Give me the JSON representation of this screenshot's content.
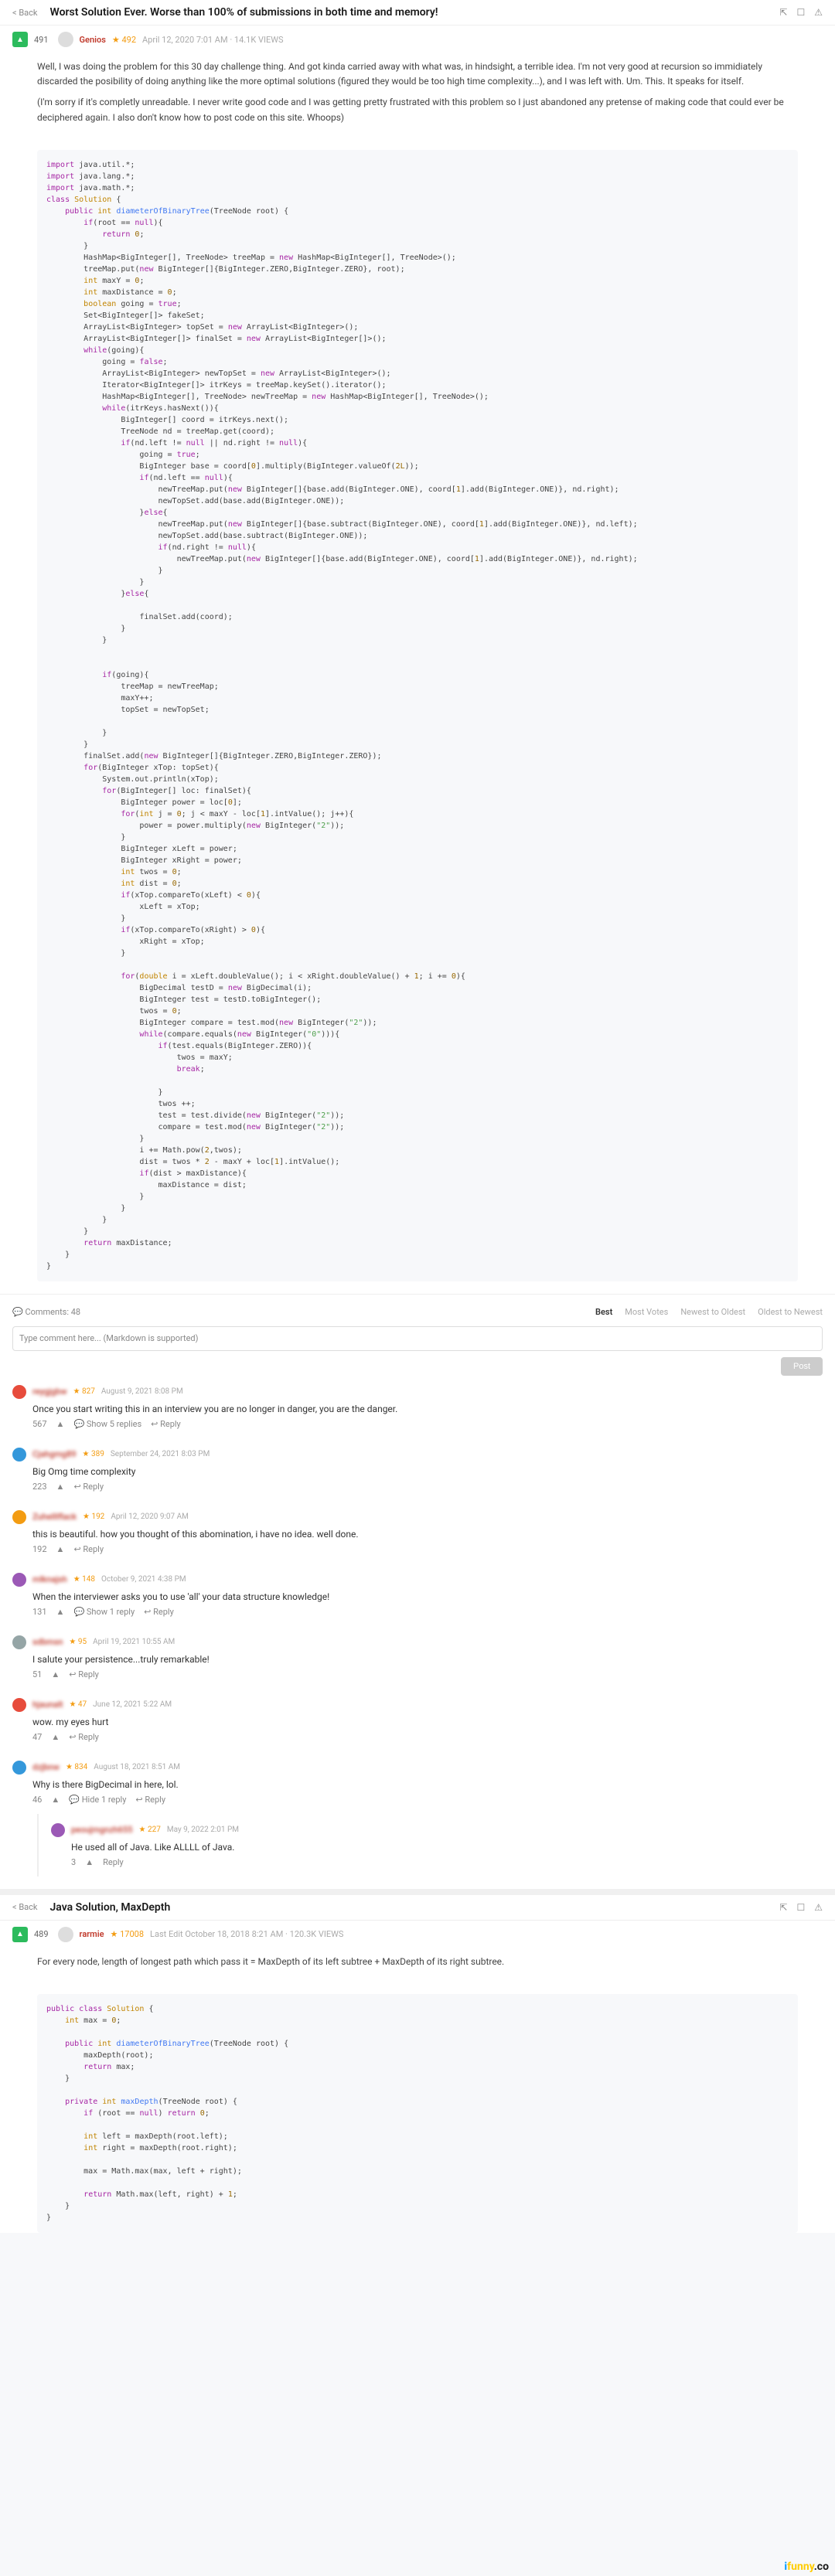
{
  "post1": {
    "back": "< Back",
    "title": "Worst Solution Ever. Worse than 100% of submissions in both time and memory!",
    "votes": "491",
    "username": "Genios",
    "reputation": "★ 492",
    "timestamp": "April 12, 2020 7:01 AM · 14.1K VIEWS",
    "para1": "Well, I was doing the problem for this 30 day challenge thing. And got kinda carried away with what was, in hindsight, a terrible idea. I'm not very good at recursion so immidiately discarded the posibility of doing anything like the more optimal solutions (figured they would be too high time complexity...), and I was left with. Um. This. It speaks for itself.",
    "para2": "(I'm sorry if it's completly unreadable. I never write good code and I was getting pretty frustrated with this problem so I just abandoned any pretense of making code that could ever be deciphered again. I also don't know how to post code on this site. Whoops)"
  },
  "comments": {
    "header": "Comments: 48",
    "sort": {
      "best": "Best",
      "most": "Most Votes",
      "newest": "Newest to Oldest",
      "oldest": "Oldest to Newest"
    },
    "placeholder": "Type comment here... (Markdown is supported)",
    "postBtn": "Post",
    "items": [
      {
        "user": "reygjgbw",
        "rep": "★ 827",
        "time": "August 9, 2021 8:08 PM",
        "text": "Once you start writing this in an interview you are no longer in danger, you are the danger.",
        "votes": "567",
        "replies": "Show 5 replies",
        "reply": "Reply"
      },
      {
        "user": "Cjahgmg89",
        "rep": "★ 389",
        "time": "September 24, 2021 8:03 PM",
        "text": "Big Omg time complexity",
        "votes": "223",
        "reply": "Reply"
      },
      {
        "user": "Zuhelllflack",
        "rep": "★ 192",
        "time": "April 12, 2020 9:07 AM",
        "text": "this is beautiful. how you thought of this abomination, i have no idea. well done.",
        "votes": "192",
        "reply": "Reply"
      },
      {
        "user": "mlknajsh",
        "rep": "★ 148",
        "time": "October 9, 2021 4:38 PM",
        "text": "When the interviewer asks you to use 'all' your data structure knowledge!",
        "votes": "131",
        "replies": "Show 1 reply",
        "reply": "Reply"
      },
      {
        "user": "sdbmsn",
        "rep": "★ 95",
        "time": "April 19, 2021 10:55 AM",
        "text": "I salute your persistence...truly remarkable!",
        "votes": "51",
        "reply": "Reply"
      },
      {
        "user": "hjaunalt",
        "rep": "★ 47",
        "time": "June 12, 2021 5:22 AM",
        "text": "wow. my eyes hurt",
        "votes": "47",
        "reply": "Reply"
      },
      {
        "user": "dzjbnw",
        "rep": "★ 834",
        "time": "August 18, 2021 8:51 AM",
        "text": "Why is there BigDecimal in here, lol.",
        "votes": "46",
        "replies": "Hide 1 reply",
        "reply": "Reply"
      }
    ],
    "nested": {
      "user": "peoujmgnzh655",
      "rep": "★ 227",
      "time": "May 9, 2022 2:01 PM",
      "text": "He used all of Java. Like ALLLL of Java.",
      "votes": "3",
      "reply": "Reply"
    }
  },
  "post2": {
    "back": "< Back",
    "title": "Java Solution, MaxDepth",
    "votes": "489",
    "username": "rarmie",
    "reputation": "★ 17008",
    "timestamp": "Last Edit October 18, 2018 8:21 AM · 120.3K VIEWS",
    "para1": "For every node, length of longest path which pass it = MaxDepth of its left subtree + MaxDepth of its right subtree."
  },
  "watermark": {
    "i": "i",
    "funny": "funny",
    "co": ".co"
  }
}
